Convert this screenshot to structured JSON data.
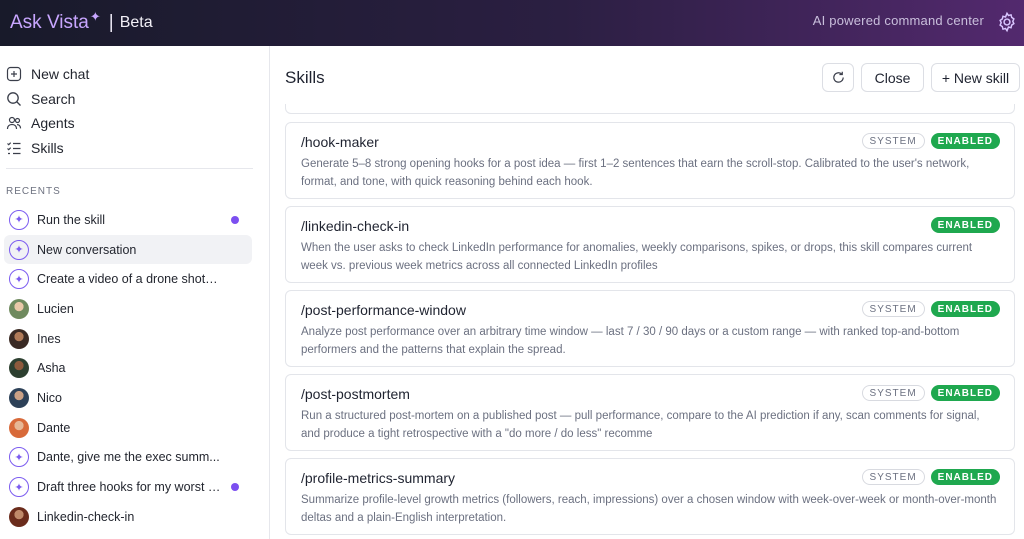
{
  "header": {
    "brand": "Ask Vista",
    "brand_sep": "|",
    "beta": "Beta",
    "tagline": "AI powered command center"
  },
  "nav": [
    {
      "label": "New chat",
      "icon": "new-chat-icon"
    },
    {
      "label": "Search",
      "icon": "search-icon"
    },
    {
      "label": "Agents",
      "icon": "agents-icon"
    },
    {
      "label": "Skills",
      "icon": "skills-icon"
    }
  ],
  "recents_label": "RECENTS",
  "recents": [
    {
      "label": "Run the skill",
      "type": "ai",
      "dot": true
    },
    {
      "label": "New conversation",
      "type": "ai",
      "active": true
    },
    {
      "label": "Create a video of a drone shot f...",
      "type": "ai"
    },
    {
      "label": "Lucien",
      "type": "avatar"
    },
    {
      "label": "Ines",
      "type": "avatar"
    },
    {
      "label": "Asha",
      "type": "avatar"
    },
    {
      "label": "Nico",
      "type": "avatar"
    },
    {
      "label": "Dante",
      "type": "avatar"
    },
    {
      "label": "Dante, give me the exec summ...",
      "type": "ai"
    },
    {
      "label": "Draft three hooks for my worst i...",
      "type": "ai",
      "dot": true
    },
    {
      "label": "Linkedin-check-in",
      "type": "avatar"
    }
  ],
  "main": {
    "title": "Skills",
    "close_label": "Close",
    "new_skill_label": "+ New skill"
  },
  "badges": {
    "system": "SYSTEM",
    "enabled": "ENABLED"
  },
  "skills": [
    {
      "name": "/hook-maker",
      "system": true,
      "enabled": true,
      "desc": "Generate 5–8 strong opening hooks for a post idea — first 1–2 sentences that earn the scroll-stop. Calibrated to the user's network, format, and tone, with quick reasoning behind each hook."
    },
    {
      "name": "/linkedin-check-in",
      "system": false,
      "enabled": true,
      "desc": "When the user asks to check LinkedIn performance for anomalies, weekly comparisons, spikes, or drops, this skill compares current week vs. previous week metrics across all connected LinkedIn profiles"
    },
    {
      "name": "/post-performance-window",
      "system": true,
      "enabled": true,
      "desc": "Analyze post performance over an arbitrary time window — last 7 / 30 / 90 days or a custom range — with ranked top-and-bottom performers and the patterns that explain the spread."
    },
    {
      "name": "/post-postmortem",
      "system": true,
      "enabled": true,
      "desc": "Run a structured post-mortem on a published post — pull performance, compare to the AI prediction if any, scan comments for signal, and produce a tight retrospective with a \"do more / do less\" recomme"
    },
    {
      "name": "/profile-metrics-summary",
      "system": true,
      "enabled": true,
      "desc": "Summarize profile-level growth metrics (followers, reach, impressions) over a chosen window with week-over-week or month-over-month deltas and a plain-English interpretation."
    }
  ],
  "colors": {
    "accent": "#7c4ff0",
    "enabled": "#1fa84f"
  }
}
